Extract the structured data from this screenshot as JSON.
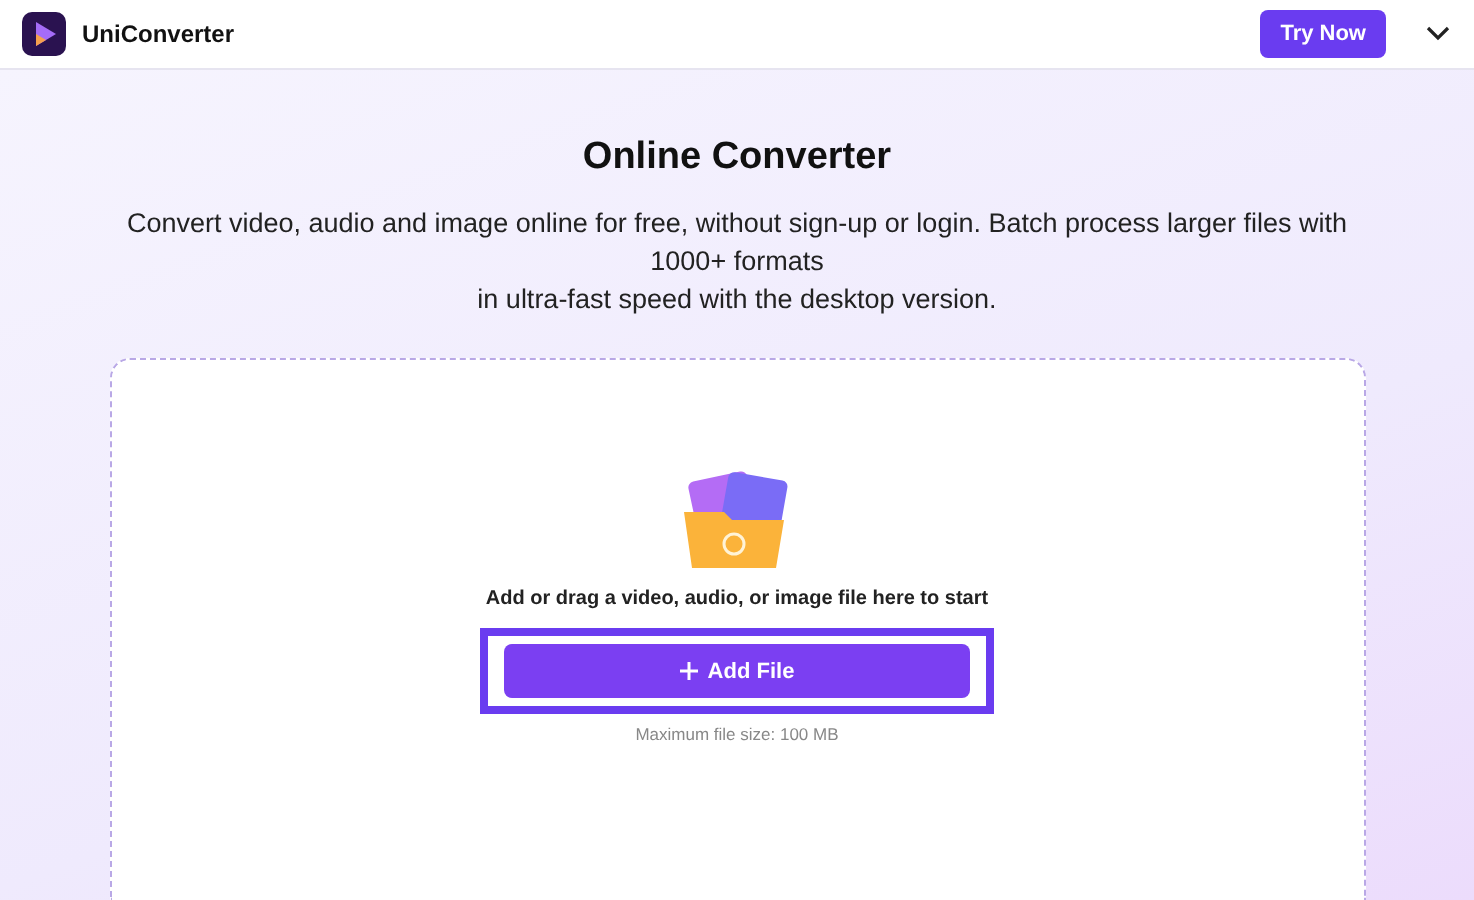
{
  "header": {
    "app_name": "UniConverter",
    "cta": "Try Now"
  },
  "hero": {
    "title": "Online Converter",
    "description_lines": [
      "Convert video, audio and image online for free, without sign-up or login. Batch process larger files with 1000+ formats",
      "in ultra-fast speed with the desktop version."
    ]
  },
  "upload": {
    "prompt": "Add or drag a video, audio, or image file here to start",
    "button": "Add File",
    "highlighted": true,
    "limit": "Maximum file size: 100 MB"
  }
}
